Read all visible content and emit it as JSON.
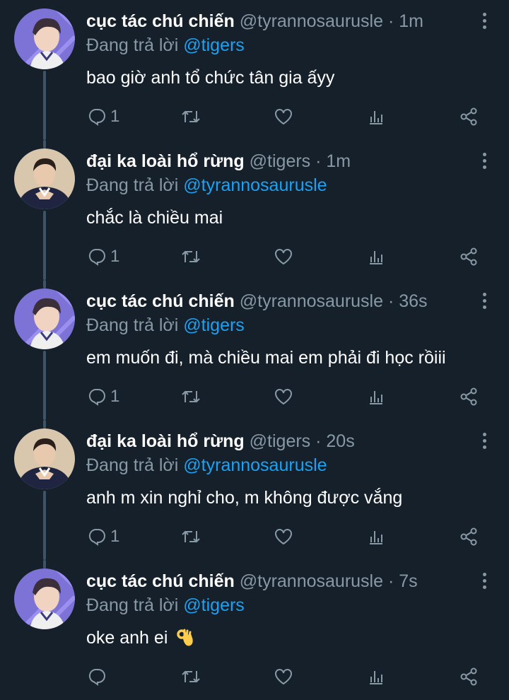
{
  "tweets": [
    {
      "name": "cục tác chú chiến",
      "handle": "@tyrannosaurusle",
      "separator": "·",
      "time": "1m",
      "replying_prefix": "Đang trả lời",
      "replying_to": "@tigers",
      "text": "bao giờ anh tổ chức tân gia ấyy",
      "reply_count": "1",
      "avatar": "avatar-purple"
    },
    {
      "name": "đại ka loài hổ rừng",
      "handle": "@tigers",
      "separator": "·",
      "time": "1m",
      "replying_prefix": "Đang trả lời",
      "replying_to": "@tyrannosaurusle",
      "text": "chắc là chiều mai",
      "reply_count": "1",
      "avatar": "avatar-beige"
    },
    {
      "name": "cục tác chú chiến",
      "handle": "@tyrannosaurusle",
      "separator": "·",
      "time": "36s",
      "replying_prefix": "Đang trả lời",
      "replying_to": "@tigers",
      "text": "em muốn đi, mà chiều mai em phải đi học rồiii",
      "reply_count": "1",
      "avatar": "avatar-purple"
    },
    {
      "name": "đại ka loài hổ rừng",
      "handle": "@tigers",
      "separator": "·",
      "time": "20s",
      "replying_prefix": "Đang trả lời",
      "replying_to": "@tyrannosaurusle",
      "text": "anh m xin nghỉ cho, m không được vắng",
      "reply_count": "1",
      "avatar": "avatar-beige"
    },
    {
      "name": "cục tác chú chiến",
      "handle": "@tyrannosaurusle",
      "separator": "·",
      "time": "7s",
      "replying_prefix": "Đang trả lời",
      "replying_to": "@tigers",
      "text": "oke anh ei",
      "emoji": "ok-hand-icon",
      "reply_count": "",
      "avatar": "avatar-purple"
    }
  ],
  "colors": {
    "background": "#15202b",
    "secondary": "#8899a6",
    "mention": "#1da1f2",
    "thread_line": "#3d5466"
  }
}
